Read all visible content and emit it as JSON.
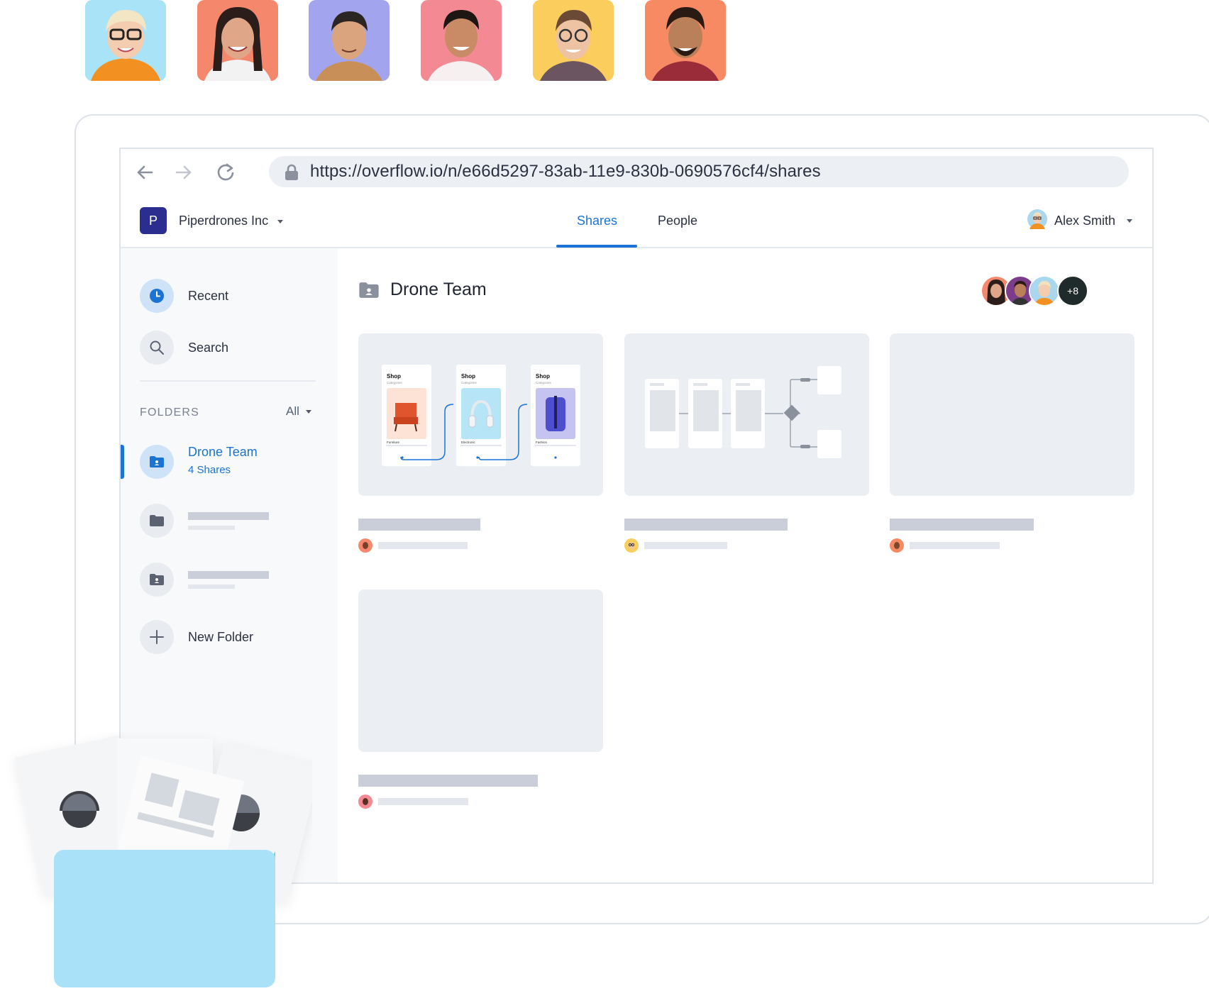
{
  "browser": {
    "url": "https://overflow.io/n/e66d5297-83ab-11e9-830b-0690576cf4/shares"
  },
  "header": {
    "org_initial": "P",
    "org_name": "Piperdrones Inc",
    "tabs": [
      {
        "label": "Shares",
        "active": true
      },
      {
        "label": "People",
        "active": false
      }
    ],
    "user_name": "Alex Smith"
  },
  "sidebar": {
    "nav": [
      {
        "label": "Recent",
        "icon": "clock-icon"
      },
      {
        "label": "Search",
        "icon": "search-icon"
      }
    ],
    "folders_heading": "FOLDERS",
    "folders_filter": "All",
    "active_folder": {
      "title": "Drone Team",
      "subtitle": "4 Shares"
    },
    "new_folder_label": "New Folder"
  },
  "main": {
    "title": "Drone Team",
    "extra_collaborators": "+8",
    "cards": [
      {
        "thumb": "shop-flow",
        "screens": [
          {
            "title": "Shop",
            "sub": "Categories",
            "item": "Furniture"
          },
          {
            "title": "Shop",
            "sub": "Categories",
            "item": "Electronic"
          },
          {
            "title": "Shop",
            "sub": "Categories",
            "item": "Fashion"
          }
        ]
      },
      {
        "thumb": "flowchart"
      },
      {
        "thumb": "blank"
      },
      {
        "thumb": "blank"
      }
    ]
  },
  "colors": {
    "accent": "#1b73d3",
    "org_logo": "#2c2e8f",
    "card_bg": "#ebeef3",
    "skeleton": "#c9ced8"
  }
}
